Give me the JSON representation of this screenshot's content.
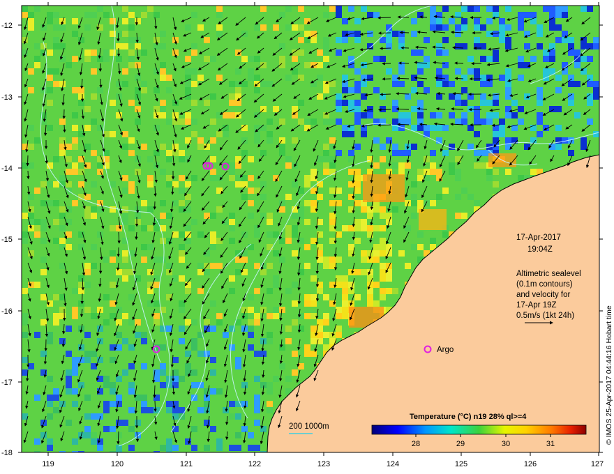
{
  "map": {
    "date": "17-Apr-2017",
    "time": "19:04Z",
    "info_lines": [
      "Altimetric sealevel",
      "(0.1m contours)",
      "and velocity for",
      "17-Apr 19Z",
      "0.5m/s (1kt 24h)"
    ],
    "argo_label": "Argo",
    "depth_legend": "200  1000m",
    "colorbar_title": "Temperature (°C) n19 28% ql>=4",
    "colorbar_ticks": [
      "28",
      "29",
      "30",
      "31"
    ],
    "credit": "© IMOS 25-Apr-2017 04:44:16 Hobart time",
    "x_ticks": [
      "119",
      "120",
      "121",
      "122",
      "123",
      "124",
      "125",
      "126",
      "127"
    ],
    "y_ticks": [
      "-12",
      "-13",
      "-14",
      "-15",
      "-16",
      "-17",
      "-18"
    ],
    "colors": {
      "ocean_base": "#5ed245",
      "land": "#fbcb9c",
      "argo_marker": "#e020e0",
      "contour": "#c8f5ff"
    }
  }
}
